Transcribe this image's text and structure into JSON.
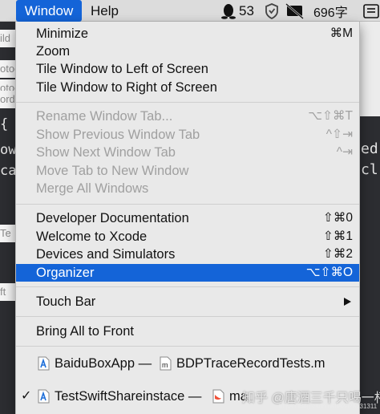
{
  "menubar": {
    "window_label": "Window",
    "help_label": "Help",
    "qq_count": "53",
    "ime_label": "696字"
  },
  "menu": {
    "items": [
      {
        "label": "Minimize",
        "shortcut": "⌘M"
      },
      {
        "label": "Zoom",
        "shortcut": ""
      },
      {
        "label": "Tile Window to Left of Screen",
        "shortcut": ""
      },
      {
        "label": "Tile Window to Right of Screen",
        "shortcut": ""
      },
      {
        "label": "Rename Window Tab...",
        "shortcut": "⌥⇧⌘T"
      },
      {
        "label": "Show Previous Window Tab",
        "shortcut": "^⇧⇥"
      },
      {
        "label": "Show Next Window Tab",
        "shortcut": "^⇥"
      },
      {
        "label": "Move Tab to New Window",
        "shortcut": ""
      },
      {
        "label": "Merge All Windows",
        "shortcut": ""
      },
      {
        "label": "Developer Documentation",
        "shortcut": "⇧⌘0"
      },
      {
        "label": "Welcome to Xcode",
        "shortcut": "⇧⌘1"
      },
      {
        "label": "Devices and Simulators",
        "shortcut": "⇧⌘2"
      },
      {
        "label": "Organizer",
        "shortcut": "⌥⇧⌘O"
      },
      {
        "label": "Touch Bar",
        "shortcut": ""
      },
      {
        "label": "Bring All to Front",
        "shortcut": ""
      },
      {
        "label": "BaiduBoxApp — ",
        "file": "BDPTraceRecordTests.m"
      },
      {
        "label": "TestSwiftShareinstace — ",
        "file": "ma"
      }
    ]
  },
  "background": {
    "left_fragments": [
      "ild",
      "otoc",
      "otoc",
      "ord",
      "{",
      "ow",
      "ca",
      "Te",
      "ft"
    ],
    "right_fragments": [
      "ed",
      "cl"
    ]
  },
  "watermark": {
    "text": "知乎 @唐酒三千只喝一杯",
    "url": "https://blog.csdn.net/a2025131311"
  },
  "colors": {
    "highlight": "#1464d8",
    "menu_bg": "#e9e9e9",
    "disabled_text": "#a0a0a0"
  }
}
